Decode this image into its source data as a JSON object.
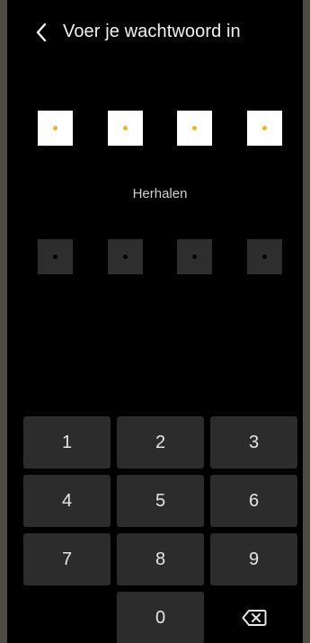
{
  "header": {
    "title": "Voer je wachtwoord in",
    "back_icon": "chevron-left-icon"
  },
  "pin_entry": {
    "filled_count": 4,
    "length": 4,
    "dot_color": "#f0b323"
  },
  "repeat": {
    "label": "Herhalen",
    "filled_count": 0,
    "length": 4
  },
  "keypad": {
    "keys": [
      "1",
      "2",
      "3",
      "4",
      "5",
      "6",
      "7",
      "8",
      "9",
      "0"
    ],
    "delete_icon": "backspace-icon"
  }
}
